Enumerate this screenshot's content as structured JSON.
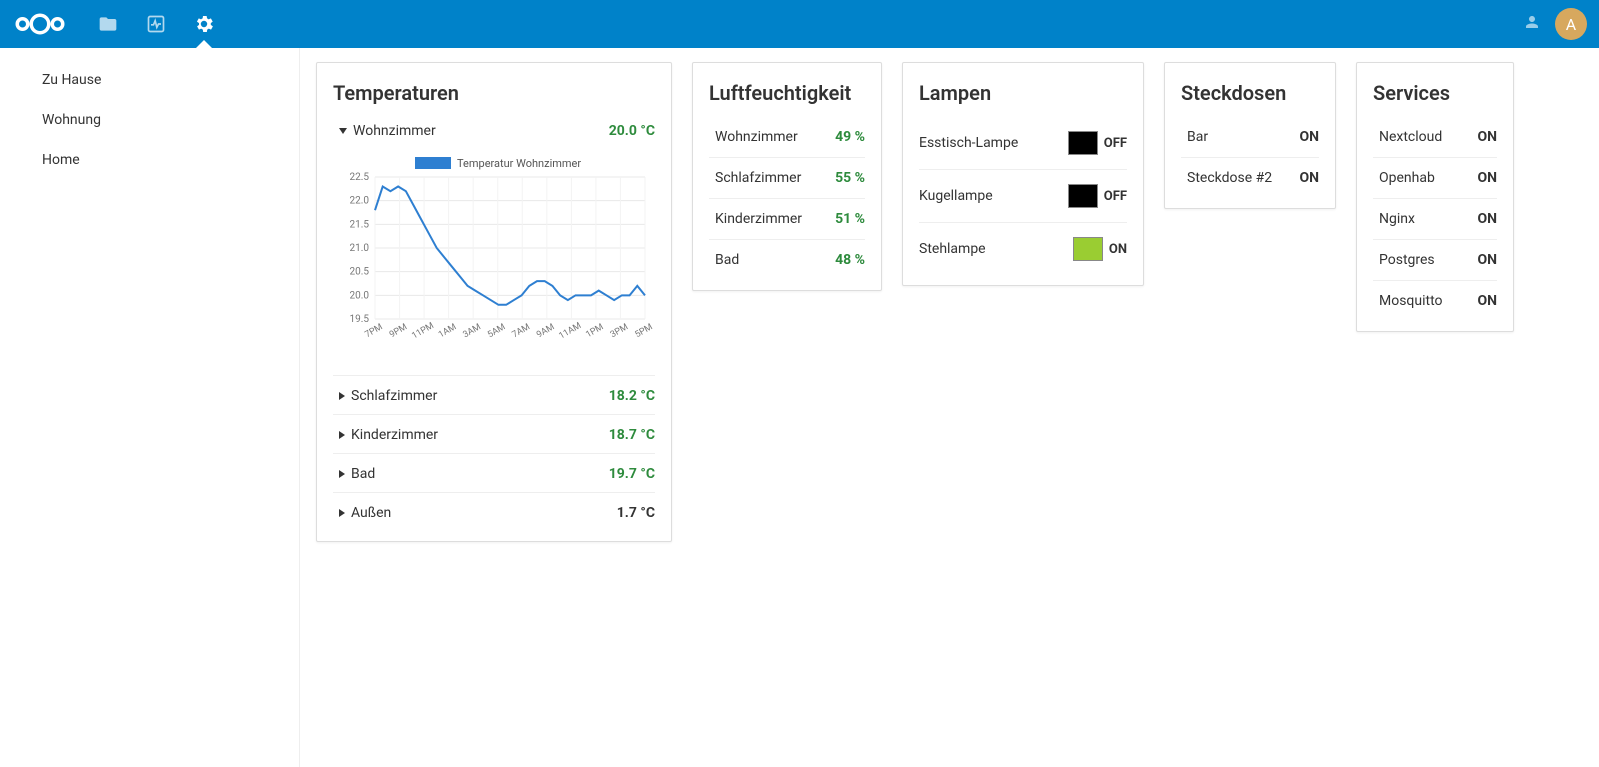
{
  "header": {
    "avatar_letter": "A"
  },
  "sidebar": {
    "items": [
      {
        "label": "Zu Hause"
      },
      {
        "label": "Wohnung"
      },
      {
        "label": "Home"
      }
    ]
  },
  "cards": {
    "temperatures": {
      "title": "Temperaturen",
      "rooms": [
        {
          "label": "Wohnzimmer",
          "value": "20.0 °C",
          "expanded": true
        },
        {
          "label": "Schlafzimmer",
          "value": "18.2 °C",
          "expanded": false
        },
        {
          "label": "Kinderzimmer",
          "value": "18.7 °C",
          "expanded": false
        },
        {
          "label": "Bad",
          "value": "19.7 °C",
          "expanded": false
        },
        {
          "label": "Außen",
          "value": "1.7 °C",
          "expanded": false,
          "neutral": true
        }
      ],
      "chart_legend": "Temperatur Wohnzimmer"
    },
    "humidity": {
      "title": "Luftfeuchtigkeit",
      "rows": [
        {
          "label": "Wohnzimmer",
          "value": "49 %"
        },
        {
          "label": "Schlafzimmer",
          "value": "55 %"
        },
        {
          "label": "Kinderzimmer",
          "value": "51 %"
        },
        {
          "label": "Bad",
          "value": "48 %"
        }
      ]
    },
    "lamps": {
      "title": "Lampen",
      "rows": [
        {
          "label": "Esstisch-Lampe",
          "state": "OFF"
        },
        {
          "label": "Kugellampe",
          "state": "OFF"
        },
        {
          "label": "Stehlampe",
          "state": "ON"
        }
      ]
    },
    "plugs": {
      "title": "Steckdosen",
      "rows": [
        {
          "label": "Bar",
          "state": "ON"
        },
        {
          "label": "Steckdose #2",
          "state": "ON"
        }
      ]
    },
    "services": {
      "title": "Services",
      "rows": [
        {
          "label": "Nextcloud",
          "state": "ON"
        },
        {
          "label": "Openhab",
          "state": "ON"
        },
        {
          "label": "Nginx",
          "state": "ON"
        },
        {
          "label": "Postgres",
          "state": "ON"
        },
        {
          "label": "Mosquitto",
          "state": "ON"
        }
      ]
    }
  },
  "chart_data": {
    "type": "line",
    "title": "",
    "legend": [
      "Temperatur Wohnzimmer"
    ],
    "ylim": [
      19.5,
      22.5
    ],
    "yticks": [
      19.5,
      20.0,
      20.5,
      21.0,
      21.5,
      22.0,
      22.5
    ],
    "xlabels": [
      "7PM",
      "9PM",
      "11PM",
      "1AM",
      "3AM",
      "5AM",
      "7AM",
      "9AM",
      "11AM",
      "1PM",
      "3PM",
      "5PM"
    ],
    "series": [
      {
        "name": "Temperatur Wohnzimmer",
        "color": "#2e7fd1",
        "values": [
          21.8,
          22.3,
          22.2,
          22.3,
          22.2,
          21.9,
          21.6,
          21.3,
          21.0,
          20.8,
          20.6,
          20.4,
          20.2,
          20.1,
          20.0,
          19.9,
          19.8,
          19.8,
          19.9,
          20.0,
          20.2,
          20.3,
          20.3,
          20.2,
          20.0,
          19.9,
          20.0,
          20.0,
          20.0,
          20.1,
          20.0,
          19.9,
          20.0,
          20.0,
          20.2,
          20.0
        ]
      }
    ]
  }
}
